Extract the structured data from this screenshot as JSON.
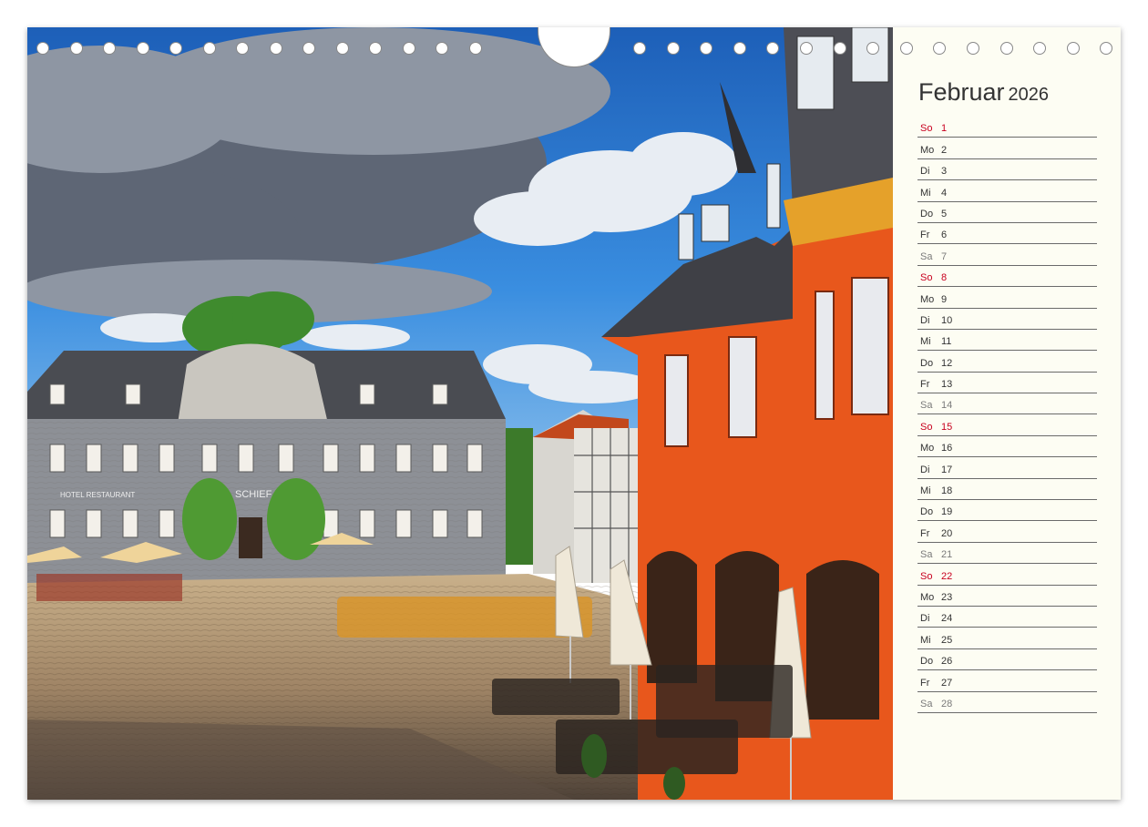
{
  "calendar": {
    "month": "Februar",
    "year": "2026",
    "days": [
      {
        "weekday": "So",
        "day": "1",
        "type": "sun"
      },
      {
        "weekday": "Mo",
        "day": "2",
        "type": "week"
      },
      {
        "weekday": "Di",
        "day": "3",
        "type": "week"
      },
      {
        "weekday": "Mi",
        "day": "4",
        "type": "week"
      },
      {
        "weekday": "Do",
        "day": "5",
        "type": "week"
      },
      {
        "weekday": "Fr",
        "day": "6",
        "type": "week"
      },
      {
        "weekday": "Sa",
        "day": "7",
        "type": "sat"
      },
      {
        "weekday": "So",
        "day": "8",
        "type": "sun"
      },
      {
        "weekday": "Mo",
        "day": "9",
        "type": "week"
      },
      {
        "weekday": "Di",
        "day": "10",
        "type": "week"
      },
      {
        "weekday": "Mi",
        "day": "11",
        "type": "week"
      },
      {
        "weekday": "Do",
        "day": "12",
        "type": "week"
      },
      {
        "weekday": "Fr",
        "day": "13",
        "type": "week"
      },
      {
        "weekday": "Sa",
        "day": "14",
        "type": "sat"
      },
      {
        "weekday": "So",
        "day": "15",
        "type": "sun"
      },
      {
        "weekday": "Mo",
        "day": "16",
        "type": "week"
      },
      {
        "weekday": "Di",
        "day": "17",
        "type": "week"
      },
      {
        "weekday": "Mi",
        "day": "18",
        "type": "week"
      },
      {
        "weekday": "Do",
        "day": "19",
        "type": "week"
      },
      {
        "weekday": "Fr",
        "day": "20",
        "type": "week"
      },
      {
        "weekday": "Sa",
        "day": "21",
        "type": "sat"
      },
      {
        "weekday": "So",
        "day": "22",
        "type": "sun"
      },
      {
        "weekday": "Mo",
        "day": "23",
        "type": "week"
      },
      {
        "weekday": "Di",
        "day": "24",
        "type": "week"
      },
      {
        "weekday": "Mi",
        "day": "25",
        "type": "week"
      },
      {
        "weekday": "Do",
        "day": "26",
        "type": "week"
      },
      {
        "weekday": "Fr",
        "day": "27",
        "type": "week"
      },
      {
        "weekday": "Sa",
        "day": "28",
        "type": "sat"
      }
    ]
  },
  "photo": {
    "signs": [
      "HOTEL RESTAURANT",
      "SCHIEF"
    ]
  },
  "colors": {
    "sunday": "#c8001e",
    "saturday": "#7a7a7a",
    "weekday": "#333333",
    "calendar_bg": "#fdfdf3",
    "facade_orange": "#e8571c",
    "sky_blue": "#2a7fd4"
  }
}
